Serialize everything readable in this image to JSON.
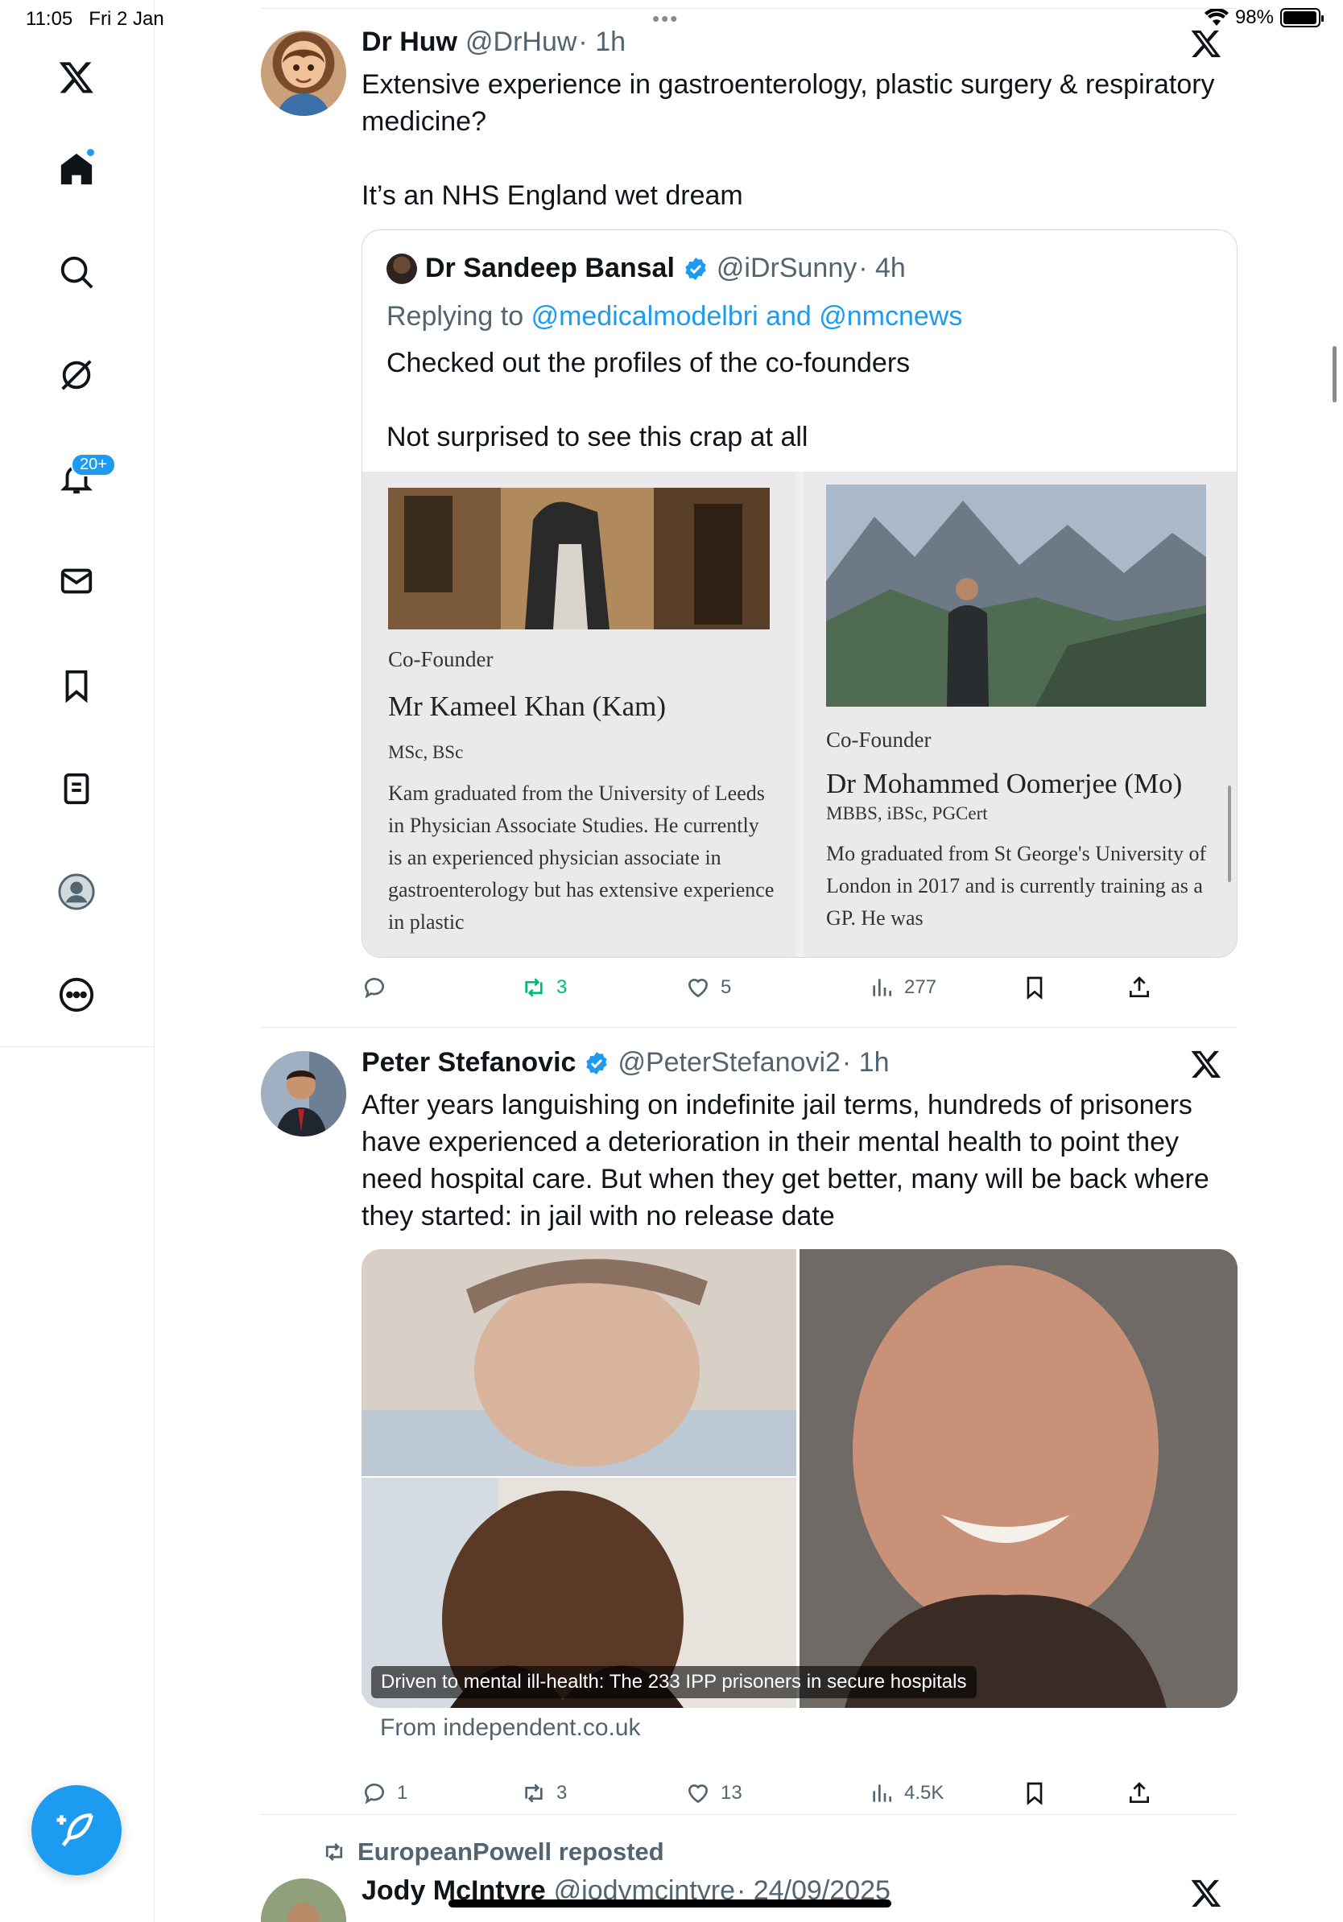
{
  "status_bar": {
    "time": "11:05",
    "date": "Fri 2 Jan",
    "battery": "98%",
    "battery_level": 0.98
  },
  "sidebar": {
    "notifications_badge": "20+"
  },
  "tweets": [
    {
      "name": "Dr Huw",
      "handle": "@DrHuw",
      "time": "· 1h",
      "text": "Extensive experience in gastroenterology, plastic surgery & respiratory medicine?\n\nIt’s an NHS England wet dream",
      "quote": {
        "name": "Dr Sandeep Bansal",
        "handle": "@iDrSunny",
        "time": "· 4h",
        "replying_prefix": "Replying to",
        "replying_to": "@medicalmodelbri and @nmcnews",
        "text": "Checked out the profiles of the co-founders\n\nNot surprised to see this crap at all",
        "cards": [
          {
            "role": "Co-Founder",
            "name": "Mr Kameel Khan (Kam)",
            "quals": "MSc, BSc",
            "bio": "Kam graduated from the University of Leeds in Physician Associate Studies. He currently is an experienced physician associate in gastroenterology but has extensive experience in plastic"
          },
          {
            "role": "Co-Founder",
            "name": "Dr Mohammed Oomerjee (Mo)",
            "quals": "MBBS, iBSc, PGCert",
            "bio": "Mo graduated from St George's University of London in 2017 and is currently training as a GP. He was"
          }
        ]
      },
      "actions": {
        "replies": "",
        "retweets": "3",
        "likes": "5",
        "views": "277"
      }
    },
    {
      "name": "Peter Stefanovic",
      "handle": "@PeterStefanovi2",
      "time": "· 1h",
      "text": "After years languishing on indefinite jail terms, hundreds of prisoners have experienced a deterioration in their mental health to point they need hospital care. But when they get better, many will be back where they started: in jail with no release date",
      "media_caption": "Driven to mental ill-health: The 233 IPP prisoners in secure hospitals",
      "source": "From independent.co.uk",
      "actions": {
        "replies": "1",
        "retweets": "3",
        "likes": "13",
        "views": "4.5K"
      }
    },
    {
      "repost_by": "EuropeanPowell reposted",
      "name": "Jody McIntyre",
      "handle": "@jodymcintyre",
      "time": "· 24/09/2025"
    }
  ]
}
